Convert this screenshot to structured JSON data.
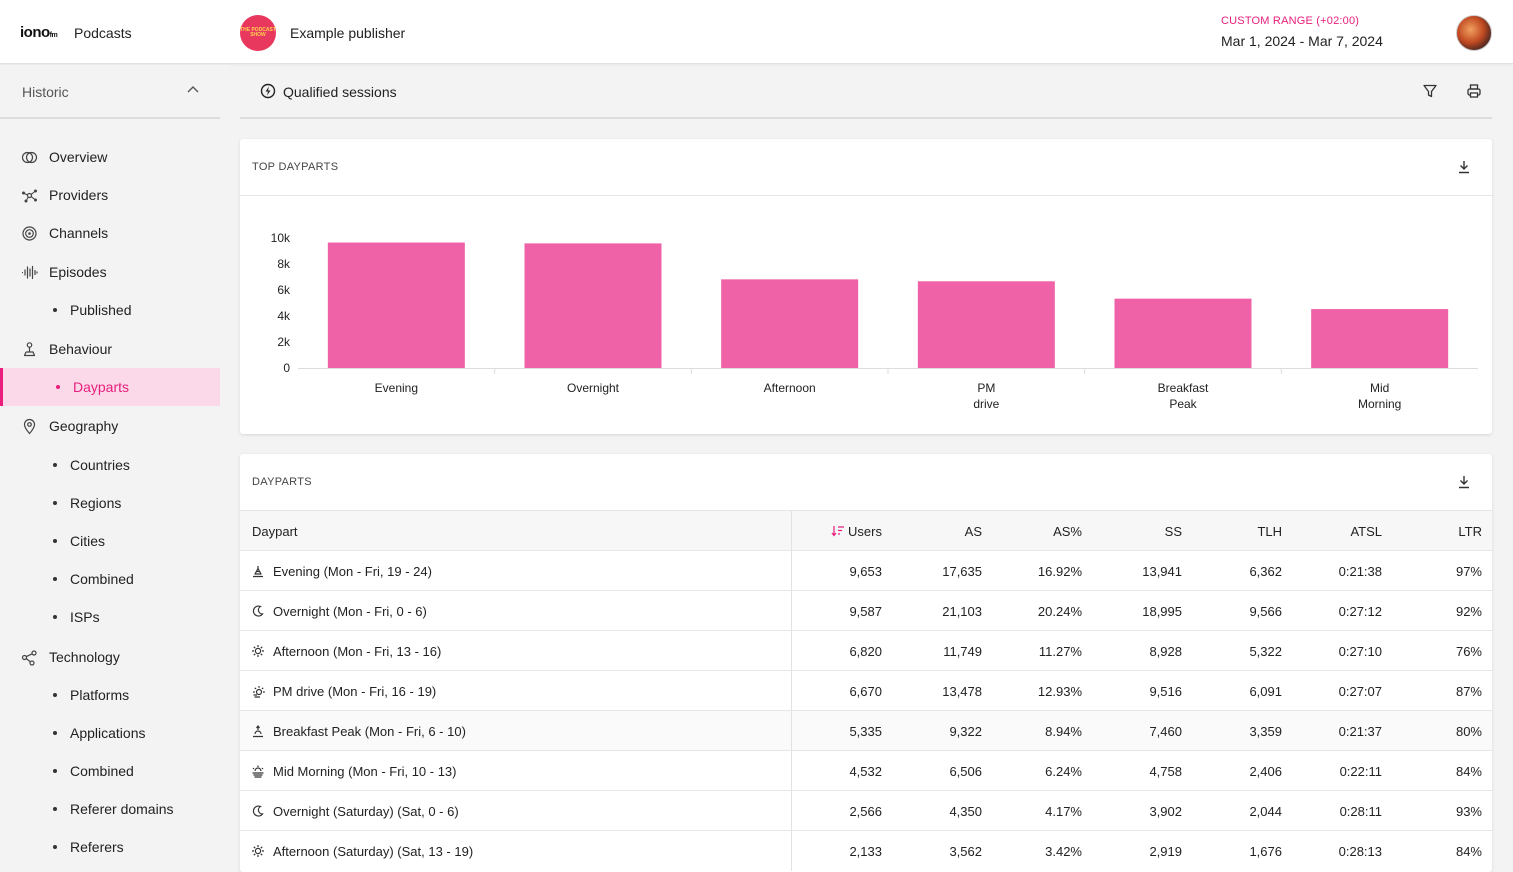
{
  "header": {
    "logo": "iono",
    "logo_suffix": "fm",
    "app_name": "Podcasts",
    "publisher_logo_text": "THE PODCAST SHOW",
    "publisher_name": "Example publisher",
    "range_label": "CUSTOM RANGE (+02:00)",
    "range_value": "Mar 1, 2024 - Mar 7, 2024"
  },
  "sidebar": {
    "section": "Historic",
    "items": [
      {
        "label": "Overview",
        "icon": "overview-icon",
        "sub": false
      },
      {
        "label": "Providers",
        "icon": "providers-icon",
        "sub": false
      },
      {
        "label": "Channels",
        "icon": "channels-icon",
        "sub": false
      },
      {
        "label": "Episodes",
        "icon": "episodes-icon",
        "sub": false
      },
      {
        "label": "Published",
        "sub": true
      },
      {
        "label": "Behaviour",
        "icon": "behaviour-icon",
        "sub": false
      },
      {
        "label": "Dayparts",
        "sub": true,
        "active": true
      },
      {
        "label": "Geography",
        "icon": "geography-icon",
        "sub": false
      },
      {
        "label": "Countries",
        "sub": true
      },
      {
        "label": "Regions",
        "sub": true
      },
      {
        "label": "Cities",
        "sub": true
      },
      {
        "label": "Combined",
        "sub": true
      },
      {
        "label": "ISPs",
        "sub": true
      },
      {
        "label": "Technology",
        "icon": "technology-icon",
        "sub": false
      },
      {
        "label": "Platforms",
        "sub": true
      },
      {
        "label": "Applications",
        "sub": true
      },
      {
        "label": "Combined",
        "sub": true
      },
      {
        "label": "Referer domains",
        "sub": true
      },
      {
        "label": "Referers",
        "sub": true
      }
    ]
  },
  "subbar": {
    "label": "Qualified sessions"
  },
  "top_card": {
    "title": "TOP DAYPARTS"
  },
  "chart_data": {
    "type": "bar",
    "title": "TOP DAYPARTS",
    "categories": [
      "Evening",
      "Overnight",
      "Afternoon",
      "PM drive",
      "Breakfast Peak",
      "Mid Morning"
    ],
    "category_lines": [
      [
        "Evening"
      ],
      [
        "Overnight"
      ],
      [
        "Afternoon"
      ],
      [
        "PM",
        "drive"
      ],
      [
        "Breakfast",
        "Peak"
      ],
      [
        "Mid",
        "Morning"
      ]
    ],
    "values": [
      9653,
      9587,
      6820,
      6670,
      5335,
      4532
    ],
    "ylim": [
      0,
      10000
    ],
    "yticks": [
      0,
      2000,
      4000,
      6000,
      8000,
      10000
    ],
    "ytick_labels": [
      "0",
      "2k",
      "4k",
      "6k",
      "8k",
      "10k"
    ],
    "color": "#f062a7",
    "xlabel": "",
    "ylabel": "",
    "grid": false
  },
  "table_card": {
    "title": "DAYPARTS",
    "columns": [
      "Daypart",
      "Users",
      "AS",
      "AS%",
      "SS",
      "TLH",
      "ATSL",
      "LTR"
    ],
    "rows": [
      {
        "icon": "evening-icon",
        "cells": [
          "Evening (Mon - Fri, 19 - 24)",
          "9,653",
          "17,635",
          "16.92%",
          "13,941",
          "6,362",
          "0:21:38",
          "97%"
        ]
      },
      {
        "icon": "moon-icon",
        "cells": [
          "Overnight (Mon - Fri, 0 - 6)",
          "9,587",
          "21,103",
          "20.24%",
          "18,995",
          "9,566",
          "0:27:12",
          "92%"
        ]
      },
      {
        "icon": "sun-icon",
        "cells": [
          "Afternoon (Mon - Fri, 13 - 16)",
          "6,820",
          "11,749",
          "11.27%",
          "8,928",
          "5,322",
          "0:27:10",
          "76%"
        ]
      },
      {
        "icon": "sun-partial-icon",
        "cells": [
          "PM drive (Mon - Fri, 16 - 19)",
          "6,670",
          "13,478",
          "12.93%",
          "9,516",
          "6,091",
          "0:27:07",
          "87%"
        ]
      },
      {
        "icon": "sunrise-icon",
        "cells": [
          "Breakfast Peak (Mon - Fri, 6 - 10)",
          "5,335",
          "9,322",
          "8.94%",
          "7,460",
          "3,359",
          "0:21:37",
          "80%"
        ]
      },
      {
        "icon": "sun-haze-icon",
        "cells": [
          "Mid Morning (Mon - Fri, 10 - 13)",
          "4,532",
          "6,506",
          "6.24%",
          "4,758",
          "2,406",
          "0:22:11",
          "84%"
        ]
      },
      {
        "icon": "moon-icon",
        "cells": [
          "Overnight (Saturday) (Sat, 0 - 6)",
          "2,566",
          "4,350",
          "4.17%",
          "3,902",
          "2,044",
          "0:28:11",
          "93%"
        ]
      },
      {
        "icon": "sun-icon",
        "cells": [
          "Afternoon (Saturday) (Sat, 13 - 19)",
          "2,133",
          "3,562",
          "3.42%",
          "2,919",
          "1,676",
          "0:28:13",
          "84%"
        ]
      }
    ]
  }
}
